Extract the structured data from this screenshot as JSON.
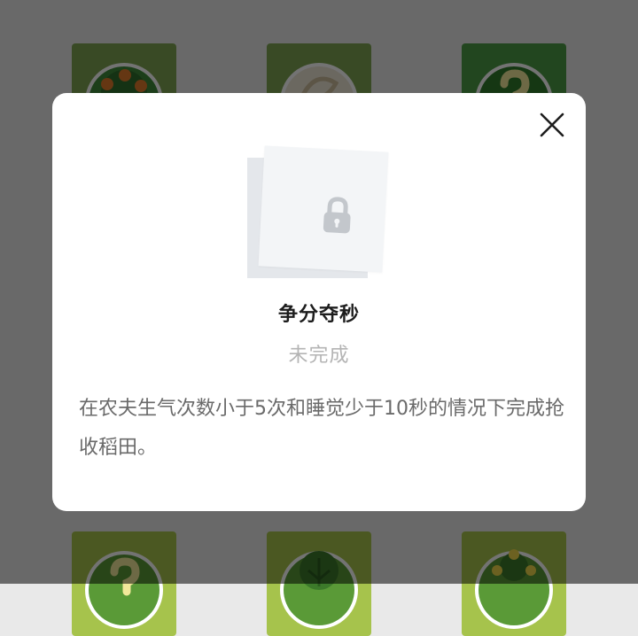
{
  "modal": {
    "title": "争分夺秒",
    "status": "未完成",
    "description": "在农夫生气次数小于5次和睡觉少于10秒的情况下完成抢收稻田。"
  },
  "icons": {
    "close": "close-icon",
    "lock": "lock-icon"
  },
  "background_badges": [
    {
      "icon": "orange-tree-icon"
    },
    {
      "icon": "dragon-coin-icon"
    },
    {
      "icon": "question-mark-icon"
    },
    {
      "icon": "question-mark-icon"
    },
    {
      "icon": "bush-icon"
    },
    {
      "icon": "sprout-tree-icon"
    }
  ],
  "colors": {
    "overlay": "rgba(0,0,0,0.55)",
    "modal_bg": "#ffffff",
    "title_text": "#1d1d1d",
    "status_text": "#b4b4b4",
    "description_text": "#6a6a6a",
    "lock_card": "#f3f5f7",
    "lock_icon": "#c3c7cc"
  }
}
